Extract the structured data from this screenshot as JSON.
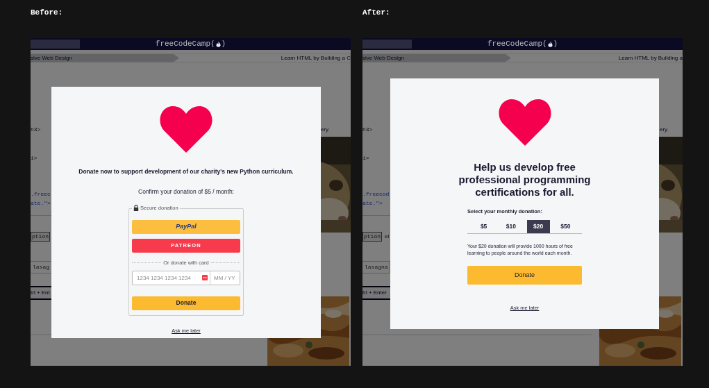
{
  "panels": [
    {
      "label": "Before:",
      "header": {
        "logo": "freeCodeCamp(",
        "logo_close": ")"
      },
      "breadcrumb": {
        "current": "sive Web Design",
        "lesson": "Learn HTML by Building a C"
      },
      "editor": [
        {
          "kind": "code",
          "text": "h3>"
        },
        {
          "kind": "code",
          "text": "i>"
        },
        {
          "kind": "link",
          "text": ".freec"
        },
        {
          "kind": "link",
          "text": "ate.\">"
        },
        {
          "kind": "tag",
          "text": "ption"
        },
        {
          "kind": "input",
          "text": "lasag"
        },
        {
          "kind": "button",
          "text": "trl + Ent"
        }
      ],
      "preview": {
        "text": "ery."
      },
      "modal": {
        "kind": "checkout",
        "message": "Donate now to support development of our charity's new Python curriculum.",
        "confirm": "Confirm your donation of $5 / month:",
        "secure_label": "Secure donation",
        "paypal": "PayPal",
        "patreon": "PATREON",
        "card_divider": "Or donate with card",
        "card_number": {
          "placeholder": "1234 1234 1234 1234"
        },
        "expiry": {
          "placeholder": "MM / YY"
        },
        "donate_button": "Donate",
        "ask_later": "Ask me later"
      }
    },
    {
      "label": "After:",
      "header": {
        "logo": "freeCodeCamp(",
        "logo_close": ")"
      },
      "breadcrumb": {
        "current": "sive Web Design",
        "lesson": "Learn HTML by Building a"
      },
      "editor": [
        {
          "kind": "code",
          "text": "h3>"
        },
        {
          "kind": "code",
          "text": "i>"
        },
        {
          "kind": "link",
          "text": ".freecod"
        },
        {
          "kind": "link",
          "text": "ate.\">"
        },
        {
          "kind": "tag",
          "text": "ption",
          "after": "el"
        },
        {
          "kind": "input",
          "text": "lasagna"
        },
        {
          "kind": "button",
          "text": "trl + Enter"
        }
      ],
      "preview": {
        "text": "ery."
      },
      "modal": {
        "kind": "tiers",
        "heading": "Help us develop free professional programming certifications for all.",
        "select_label": "Select your monthly donation:",
        "amounts": [
          {
            "label": "$5",
            "selected": false
          },
          {
            "label": "$10",
            "selected": false
          },
          {
            "label": "$20",
            "selected": true
          },
          {
            "label": "$50",
            "selected": false
          }
        ],
        "impact": "Your $20 donation will provide 1000 hours of free learning to people around the world each month.",
        "donate_button": "Donate",
        "ask_later": "Ask me later"
      }
    }
  ]
}
